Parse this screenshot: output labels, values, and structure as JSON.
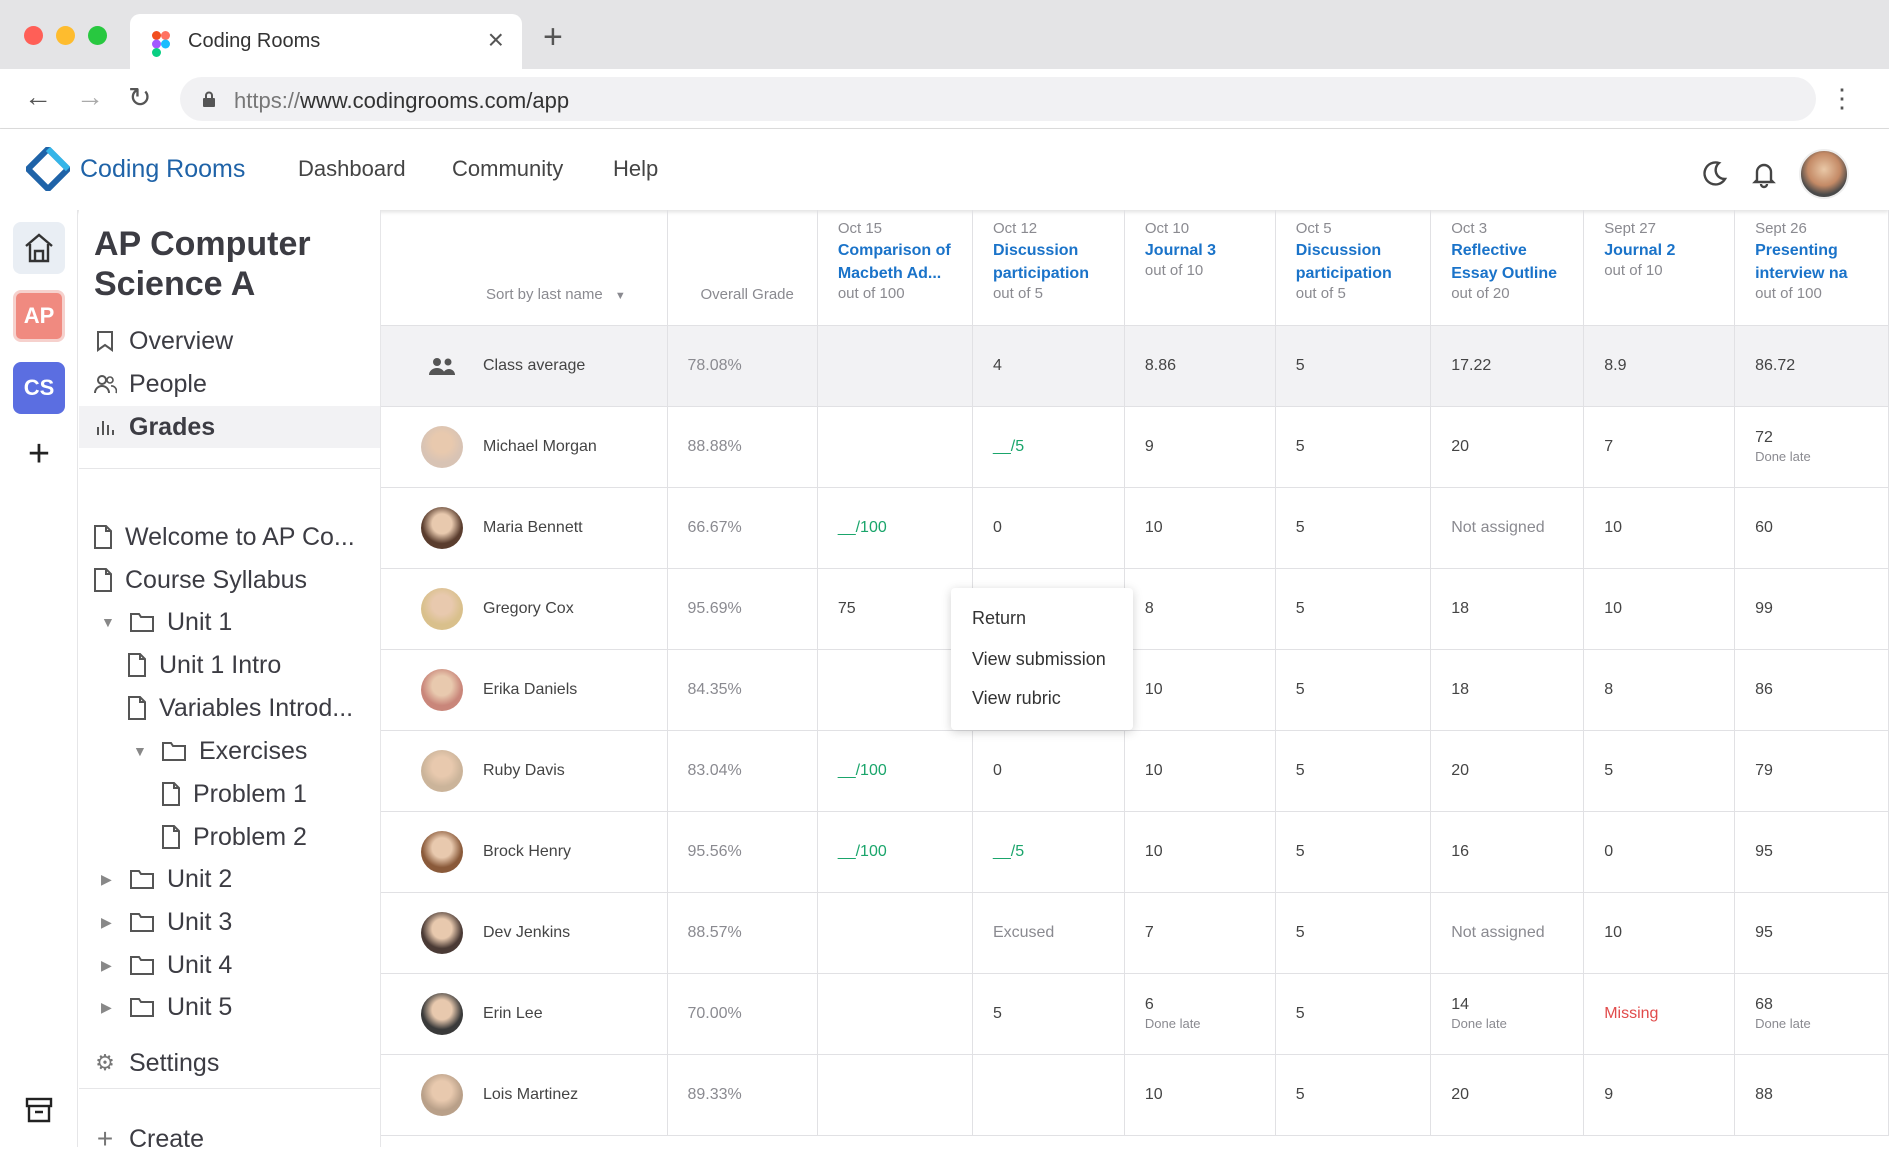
{
  "browser": {
    "tab_title": "Coding Rooms",
    "url_prefix": "https://",
    "url_host": "www.codingrooms.com/app"
  },
  "topnav": {
    "brand": "Coding Rooms",
    "menu": [
      "Dashboard",
      "Community",
      "Help"
    ]
  },
  "rail": {
    "ap": "AP",
    "cs": "CS",
    "add": "+"
  },
  "sidebar": {
    "course_title": "AP Computer Science A",
    "nav": [
      "Overview",
      "People",
      "Grades"
    ],
    "tree": [
      "Welcome to AP Co...",
      "Course Syllabus",
      "Unit 1",
      "Unit 1 Intro",
      "Variables Introd...",
      "Exercises",
      "Problem 1",
      "Problem 2",
      "Unit 2",
      "Unit 3",
      "Unit 4",
      "Unit 5"
    ],
    "settings": "Settings",
    "create": "Create"
  },
  "gradebook": {
    "sort_label": "Sort by last name",
    "overall_label": "Overall Grade",
    "assignments": [
      {
        "date": "Oct 15",
        "title": "Comparison of Macbeth Ad...",
        "out_of": "out of 100"
      },
      {
        "date": "Oct 12",
        "title": "Discussion participation",
        "out_of": "out of 5"
      },
      {
        "date": "Oct 10",
        "title": "Journal 3",
        "out_of": "out of 10"
      },
      {
        "date": "Oct 5",
        "title": "Discussion participation",
        "out_of": "out of 5"
      },
      {
        "date": "Oct 3",
        "title": "Reflective Essay Outline",
        "out_of": "out of 20"
      },
      {
        "date": "Sept 27",
        "title": "Journal 2",
        "out_of": "out of 10"
      },
      {
        "date": "Sept 26",
        "title": "Presenting interview na",
        "out_of": "out of 100"
      }
    ],
    "class_average": {
      "label": "Class average",
      "overall": "78.08%",
      "scores": [
        "",
        "4",
        "8.86",
        "5",
        "17.22",
        "8.9",
        "86.72"
      ]
    },
    "students": [
      {
        "name": "Michael Morgan",
        "overall": "88.88%",
        "scores": [
          "",
          "__/5",
          "9",
          "5",
          "20",
          "7",
          "72"
        ],
        "late": [
          "",
          "",
          "",
          "",
          "",
          "",
          "Done late"
        ]
      },
      {
        "name": "Maria Bennett",
        "overall": "66.67%",
        "scores": [
          "__/100",
          "0",
          "10",
          "5",
          "Not assigned",
          "10",
          "60"
        ],
        "late": [
          "",
          "",
          "",
          "",
          "",
          "",
          ""
        ]
      },
      {
        "name": "Gregory Cox",
        "overall": "95.69%",
        "scores": [
          "75",
          "",
          "8",
          "5",
          "18",
          "10",
          "99"
        ],
        "late": [
          "",
          "",
          "",
          "",
          "",
          "",
          ""
        ]
      },
      {
        "name": "Erika Daniels",
        "overall": "84.35%",
        "scores": [
          "",
          "",
          "10",
          "5",
          "18",
          "8",
          "86"
        ],
        "late": [
          "",
          "",
          "",
          "",
          "",
          "",
          ""
        ]
      },
      {
        "name": "Ruby Davis",
        "overall": "83.04%",
        "scores": [
          "__/100",
          "0",
          "10",
          "5",
          "20",
          "5",
          "79"
        ],
        "late": [
          "",
          "",
          "",
          "",
          "",
          "",
          ""
        ]
      },
      {
        "name": "Brock Henry",
        "overall": "95.56%",
        "scores": [
          "__/100",
          "__/5",
          "10",
          "5",
          "16",
          "0",
          "95"
        ],
        "late": [
          "",
          "",
          "",
          "",
          "",
          "",
          ""
        ]
      },
      {
        "name": "Dev Jenkins",
        "overall": "88.57%",
        "scores": [
          "",
          "Excused",
          "7",
          "5",
          "Not assigned",
          "10",
          "95"
        ],
        "late": [
          "",
          "",
          "",
          "",
          "",
          "",
          ""
        ]
      },
      {
        "name": "Erin Lee",
        "overall": "70.00%",
        "scores": [
          "",
          "5",
          "6",
          "5",
          "14",
          "Missing",
          "68"
        ],
        "late": [
          "",
          "",
          "Done late",
          "",
          "Done late",
          "",
          "Done late"
        ]
      },
      {
        "name": "Lois Martinez",
        "overall": "89.33%",
        "scores": [
          "",
          "",
          "10",
          "5",
          "20",
          "9",
          "88"
        ],
        "late": [
          "",
          "",
          "",
          "",
          "",
          "",
          ""
        ]
      }
    ]
  },
  "context_menu": [
    "Return",
    "View submission",
    "View rubric"
  ],
  "colors": {
    "brand": "#1f63a8",
    "link": "#1a73c9",
    "green": "#1aa56b",
    "missing": "#e14b4b",
    "ap": "#f08a80",
    "cs": "#5b6ee1"
  }
}
